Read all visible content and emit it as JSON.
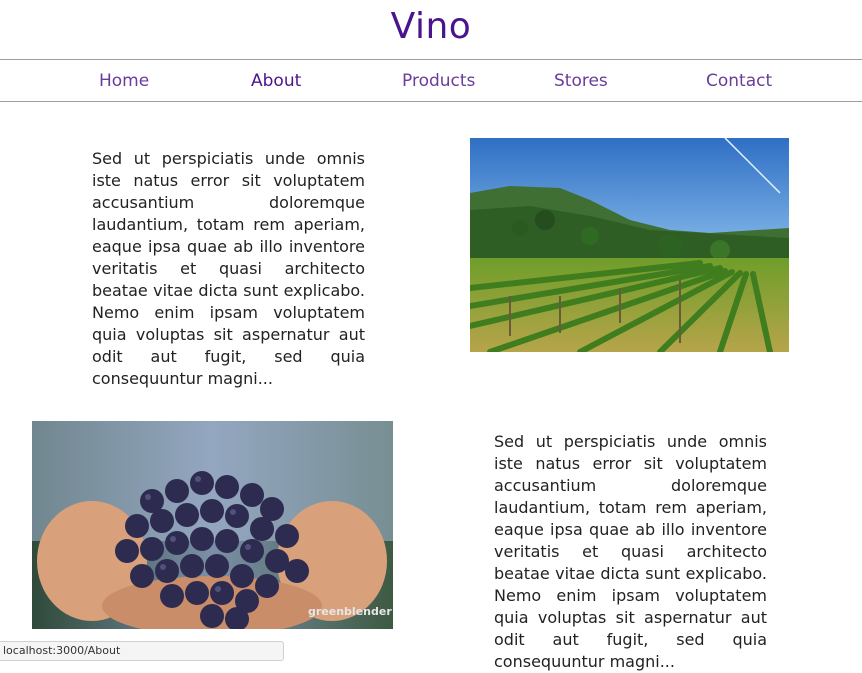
{
  "brand": "Vino",
  "nav": {
    "items": [
      {
        "label": "Home",
        "active": false
      },
      {
        "label": "About",
        "active": true
      },
      {
        "label": "Products",
        "active": false
      },
      {
        "label": "Stores",
        "active": false
      },
      {
        "label": "Contact",
        "active": false
      }
    ]
  },
  "sections": {
    "first_text": "Sed ut perspiciatis unde omnis iste natus error sit voluptatem accusantium doloremque laudantium, totam rem aperiam, eaque ipsa quae ab illo inventore veritatis et quasi architecto beatae vitae dicta sunt explicabo. Nemo enim ipsam voluptatem quia voluptas sit aspernatur aut odit aut fugit, sed quia consequuntur magni...",
    "second_text": "Sed ut perspiciatis unde omnis iste natus error sit voluptatem accusantium doloremque laudantium, totam rem aperiam, eaque ipsa quae ab illo inventore veritatis et quasi architecto beatae vitae dicta sunt explicabo. Nemo enim ipsam voluptatem quia voluptas sit aspernatur aut odit aut fugit, sed quia consequuntur magni...",
    "grapes_watermark": "greenblender"
  },
  "status_url": "localhost:3000/About",
  "colors": {
    "brand": "#4a148c",
    "nav_link": "#6a3c9b",
    "nav_active": "#4a148c"
  }
}
